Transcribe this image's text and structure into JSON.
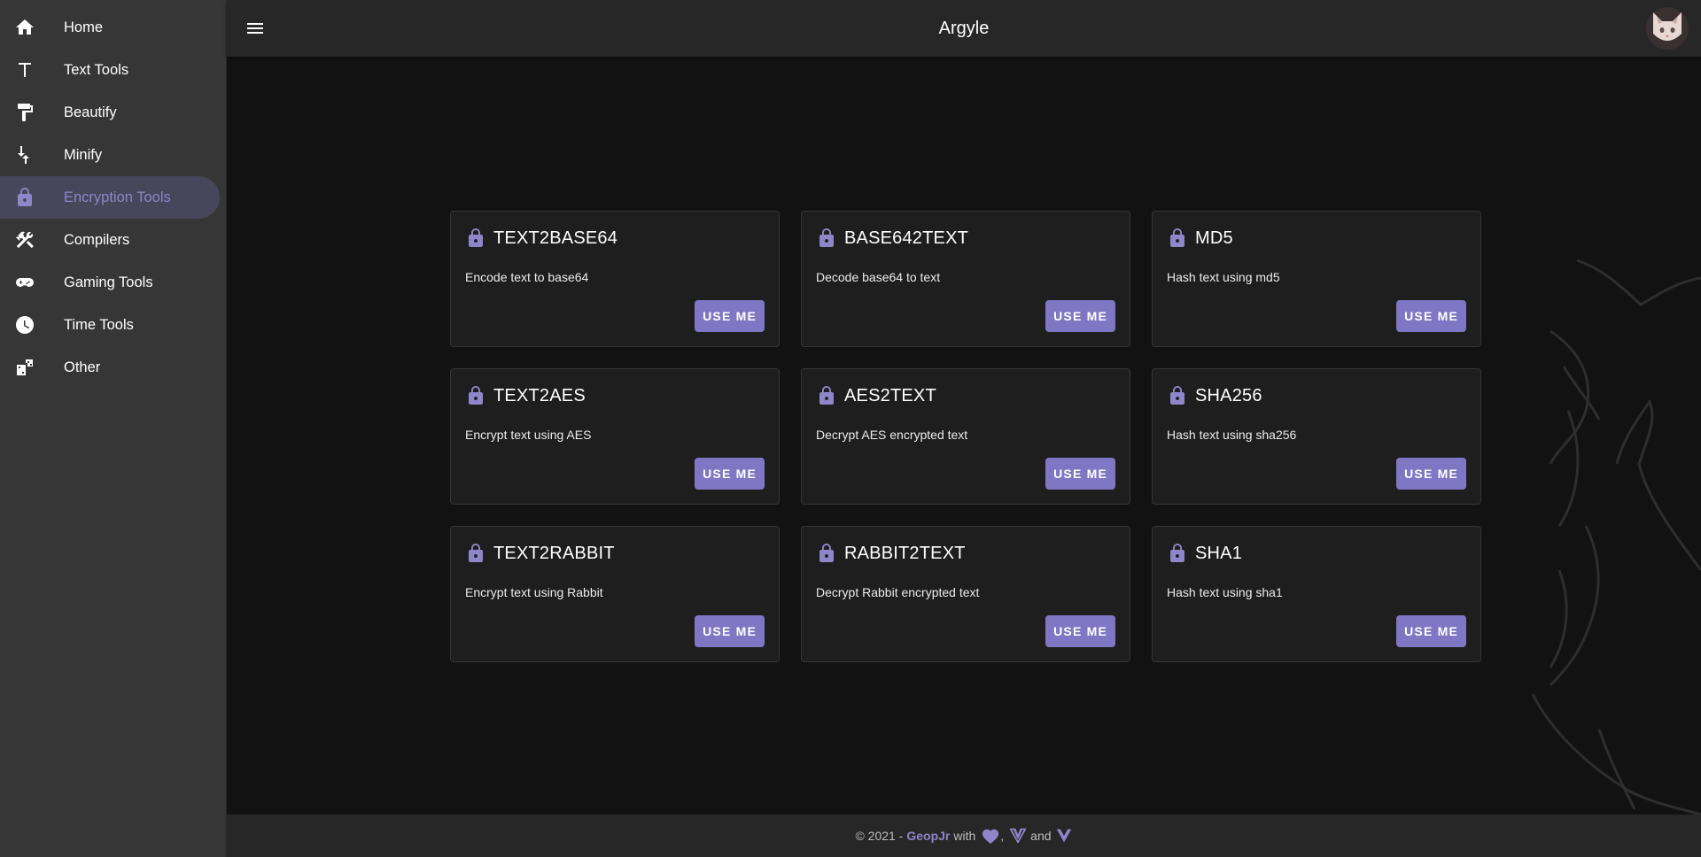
{
  "app": {
    "title": "Argyle"
  },
  "sidebar": {
    "items": [
      {
        "label": "Home",
        "icon": "home-icon",
        "active": false
      },
      {
        "label": "Text Tools",
        "icon": "text-format-icon",
        "active": false
      },
      {
        "label": "Beautify",
        "icon": "paint-roller-icon",
        "active": false
      },
      {
        "label": "Minify",
        "icon": "minify-arrows-icon",
        "active": false
      },
      {
        "label": "Encryption Tools",
        "icon": "lock-icon",
        "active": true
      },
      {
        "label": "Compilers",
        "icon": "tools-icon",
        "active": false
      },
      {
        "label": "Gaming Tools",
        "icon": "gamepad-icon",
        "active": false
      },
      {
        "label": "Time Tools",
        "icon": "clock-icon",
        "active": false
      },
      {
        "label": "Other",
        "icon": "dice-icon",
        "active": false
      }
    ]
  },
  "cards": [
    {
      "title": "TEXT2BASE64",
      "description": "Encode text to base64",
      "button": "USE ME"
    },
    {
      "title": "BASE642TEXT",
      "description": "Decode base64 to text",
      "button": "USE ME"
    },
    {
      "title": "MD5",
      "description": "Hash text using md5",
      "button": "USE ME"
    },
    {
      "title": "TEXT2AES",
      "description": "Encrypt text using AES",
      "button": "USE ME"
    },
    {
      "title": "AES2TEXT",
      "description": "Decrypt AES encrypted text",
      "button": "USE ME"
    },
    {
      "title": "SHA256",
      "description": "Hash text using sha256",
      "button": "USE ME"
    },
    {
      "title": "TEXT2RABBIT",
      "description": "Encrypt text using Rabbit",
      "button": "USE ME"
    },
    {
      "title": "RABBIT2TEXT",
      "description": "Decrypt Rabbit encrypted text",
      "button": "USE ME"
    },
    {
      "title": "SHA1",
      "description": "Hash text using sha1",
      "button": "USE ME"
    }
  ],
  "footer": {
    "prefix": "© 2021 -",
    "author": "GeopJr",
    "with": "with",
    "comma": ",",
    "and": "and"
  },
  "colors": {
    "accent": "#8f85c9",
    "button": "#8077c4",
    "background": "#121212",
    "sidebar": "#363636"
  }
}
